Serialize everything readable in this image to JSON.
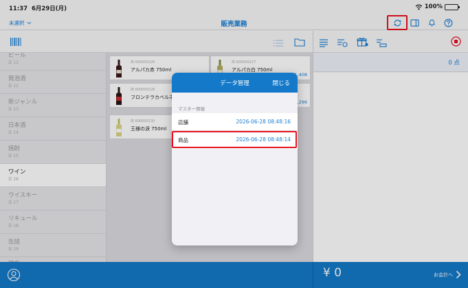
{
  "status": {
    "time": "11:37",
    "date": "6月29日(月)",
    "battery": "100%"
  },
  "nav": {
    "select_label": "未選択",
    "title": "販売業務"
  },
  "categories": [
    {
      "name": "ビール",
      "count": "☰ 11"
    },
    {
      "name": "発泡酒",
      "count": "☰ 12"
    },
    {
      "name": "新ジャンル",
      "count": "☰ 13"
    },
    {
      "name": "日本酒",
      "count": "☰ 14"
    },
    {
      "name": "焼酎",
      "count": "☰ 15"
    },
    {
      "name": "ワイン",
      "count": "☰ 16"
    },
    {
      "name": "ウイスキー",
      "count": "☰ 17"
    },
    {
      "name": "リキュール",
      "count": "☰ 18"
    },
    {
      "name": "缶詰",
      "count": "☰ 19"
    },
    {
      "name": "雑貨",
      "count": ""
    }
  ],
  "products": [
    {
      "code": "商 600000226",
      "name": "アルパカ赤 750ml",
      "price": ""
    },
    {
      "code": "商 600000227",
      "name": "アルパカ白 750ml",
      "price": "1,408"
    },
    {
      "code": "商 600000228",
      "name": "フロンテラカベルネ",
      "price": ""
    },
    {
      "code": "",
      "name": "",
      "price": "1,296"
    },
    {
      "code": "商 600000230",
      "name": "王様の涙 750ml",
      "price": ""
    }
  ],
  "cart": {
    "count": "0 点",
    "total": "¥ 0",
    "checkout_label": "お会計へ"
  },
  "modal": {
    "title": "データ管理",
    "close_label": "閉じる",
    "section": "マスター情報",
    "rows": [
      {
        "label": "店舗",
        "updated": "2026-06-28 08:48:16"
      },
      {
        "label": "商品",
        "updated": "2026-06-28 08:48:14"
      }
    ]
  },
  "colors": {
    "accent": "#1479c8",
    "highlight": "#e8101e"
  }
}
